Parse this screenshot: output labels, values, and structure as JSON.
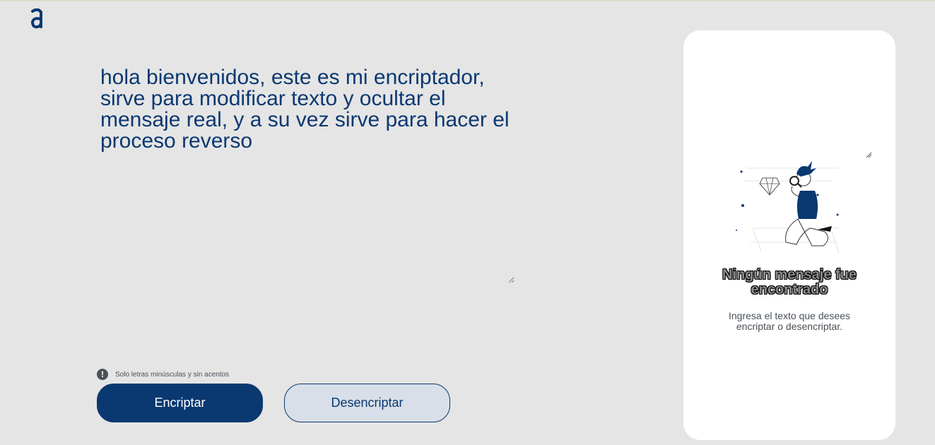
{
  "logo": {
    "icon": "alura-logo-icon"
  },
  "editor": {
    "text": "hola bienvenidos, este es mi encriptador, sirve para modificar texto y ocultar el mensaje real, y a su vez sirve para hacer el proceso reverso"
  },
  "hint": {
    "icon": "exclamation-icon",
    "text": "Solo letras minúsculas y sin acentos"
  },
  "buttons": {
    "encrypt": "Encriptar",
    "decrypt": "Desencriptar"
  },
  "output": {
    "title": "Ningún mensaje fue encontrado",
    "subtitle": "Ingresa el texto que desees encriptar o desencriptar."
  },
  "colors": {
    "primary": "#0a3871",
    "secondary_bg": "#d8dfe8",
    "page_bg": "#e5e5e5"
  }
}
